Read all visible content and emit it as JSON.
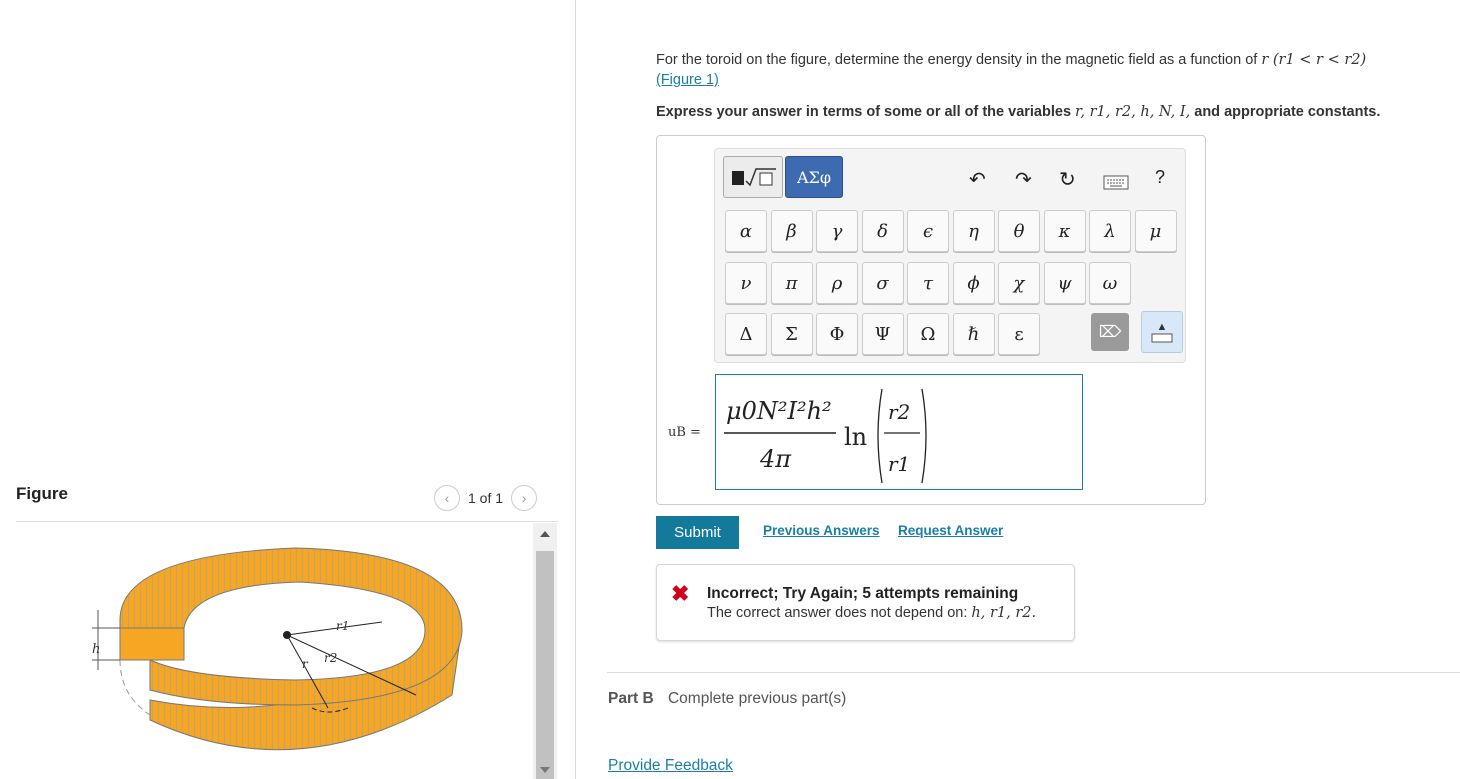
{
  "figure_panel": {
    "title": "Figure",
    "pager_text": "1 of 1",
    "labels": {
      "r1": "r1",
      "r2": "r2",
      "r": "r",
      "h": "h"
    }
  },
  "question": {
    "text": "For the toroid on the figure, determine the energy density in the magnetic field as a function of",
    "var_expr": "r (r1 < r < r2)",
    "figure_link": "(Figure 1)",
    "express_prefix": "Express your answer in terms of some or all of the variables",
    "express_vars": "r, r1, r2, h, N, I,",
    "express_suffix": "and appropriate constants."
  },
  "toolbar": {
    "template_button": "■√□",
    "greek_button": "ΑΣφ",
    "help": "?"
  },
  "greek_rows": [
    [
      "α",
      "β",
      "γ",
      "δ",
      "ϵ",
      "η",
      "θ",
      "κ",
      "λ",
      "μ"
    ],
    [
      "ν",
      "π",
      "ρ",
      "σ",
      "τ",
      "ϕ",
      "χ",
      "ψ",
      "ω"
    ],
    [
      "Δ",
      "Σ",
      "Φ",
      "Ψ",
      "Ω",
      "ℏ",
      "ε"
    ]
  ],
  "answer": {
    "label": "uB =",
    "numerator": "μ0N²I²h²",
    "denominator": "4π",
    "ln": "ln",
    "ratio_top": "r2",
    "ratio_bottom": "r1"
  },
  "actions": {
    "submit": "Submit",
    "previous": "Previous Answers",
    "request": "Request Answer"
  },
  "feedback": {
    "title": "Incorrect; Try Again; 5 attempts remaining",
    "message": "The correct answer does not depend on:",
    "vars": "h, r1, r2."
  },
  "part_b": {
    "label": "Part B",
    "status": "Complete previous part(s)"
  },
  "provide_feedback": "Provide Feedback",
  "colors": {
    "accent": "#137a9c",
    "link": "#1a7fa8",
    "error": "#d0021b",
    "toroid": "#f5a623"
  }
}
